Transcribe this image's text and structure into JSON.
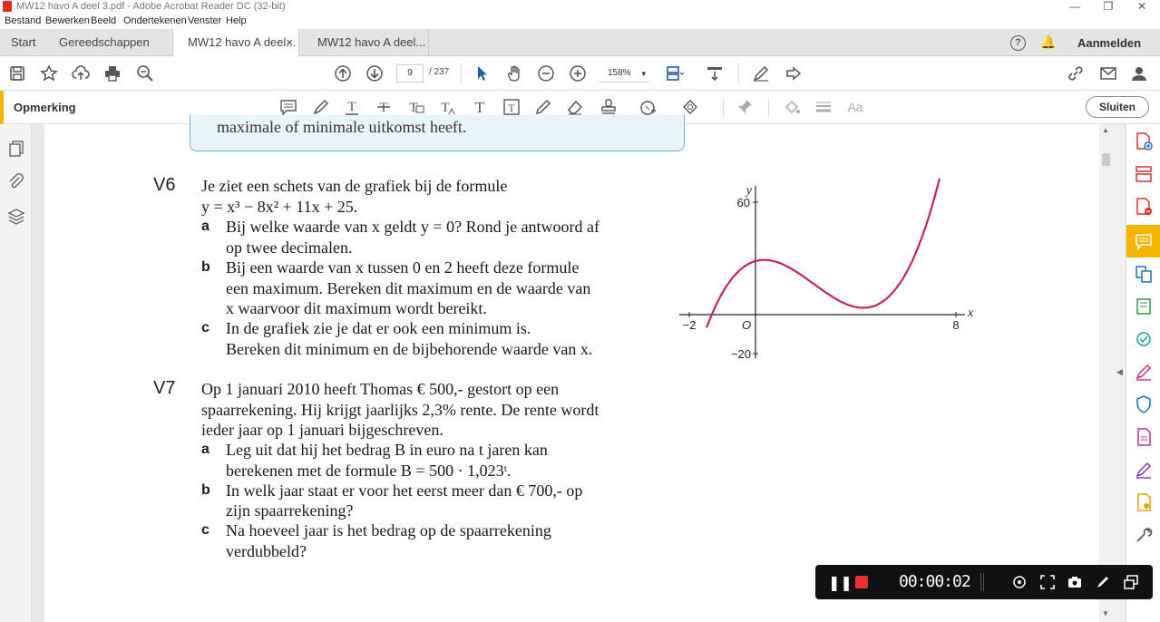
{
  "window": {
    "title": "MW12 havo A deel 3.pdf - Adobe Acrobat Reader DC (32-bit)",
    "minimize": "—",
    "maximize": "❐",
    "close": "✕"
  },
  "menu": [
    "Bestand",
    "Bewerken",
    "Beeld",
    "Ondertekenen",
    "Venster",
    "Help"
  ],
  "tabs": {
    "start": "Start",
    "tools": "Gereedschappen",
    "doc1": "MW12 havo A deel...",
    "doc1_close": "×",
    "doc2": "MW12 havo A deel...",
    "signin": "Aanmelden",
    "help_icon": "?",
    "bell_icon": "🔔"
  },
  "toolbar": {
    "page_current": "9",
    "page_total": "/ 237",
    "zoom": "158%",
    "zoom_arrow": "▾"
  },
  "comment_bar": {
    "label": "Opmerking",
    "close_label": "Sluiten"
  },
  "document": {
    "callout_text": "maximale of minimale uitkomst heeft.",
    "v6": {
      "number": "V6",
      "intro1": "Je ziet een schets van de grafiek bij de formule",
      "intro2": "y = x³ − 8x² + 11x + 25.",
      "a_label": "a",
      "a1": "Bij welke waarde van x geldt y = 0? Rond je antwoord af",
      "a2": "op twee decimalen.",
      "b_label": "b",
      "b1": "Bij een waarde van x tussen 0 en 2 heeft deze formule",
      "b2": "een maximum. Bereken dit maximum en de waarde van",
      "b3": "x waarvoor dit maximum wordt bereikt.",
      "c_label": "c",
      "c1": "In de grafiek zie je dat er ook een minimum is.",
      "c2": "Bereken dit minimum en de bijbehorende waarde van x."
    },
    "v7": {
      "number": "V7",
      "intro1": "Op 1 januari 2010 heeft Thomas € 500,- gestort op een",
      "intro2": "spaarrekening. Hij krijgt jaarlijks 2,3% rente. De rente wordt",
      "intro3": "ieder jaar op 1 januari bijgeschreven.",
      "a_label": "a",
      "a1": "Leg uit dat hij het bedrag B in euro na t jaren kan",
      "a2": "berekenen met de formule B = 500 · 1,023ᵗ.",
      "b_label": "b",
      "b1": "In welk jaar staat er voor het eerst meer dan € 700,- op",
      "b2": "zijn spaarrekening?",
      "c_label": "c",
      "c1": "Na hoeveel jaar is het bedrag op de spaarrekening",
      "c2": "verdubbeld?"
    }
  },
  "chart_data": {
    "type": "line",
    "formula": "y = x³ − 8x² + 11x + 25",
    "x_axis_label": "x",
    "y_axis_label": "y",
    "origin_label": "O",
    "x_tick_labels": [
      "−2",
      "8"
    ],
    "y_tick_labels": [
      "60",
      "−20"
    ],
    "xlim": [
      -2,
      8
    ],
    "ylim": [
      -20,
      60
    ],
    "grid": false,
    "curve_color": "#c8264b"
  },
  "recorder": {
    "pause": "❚❚",
    "timer": "00:00:02"
  }
}
